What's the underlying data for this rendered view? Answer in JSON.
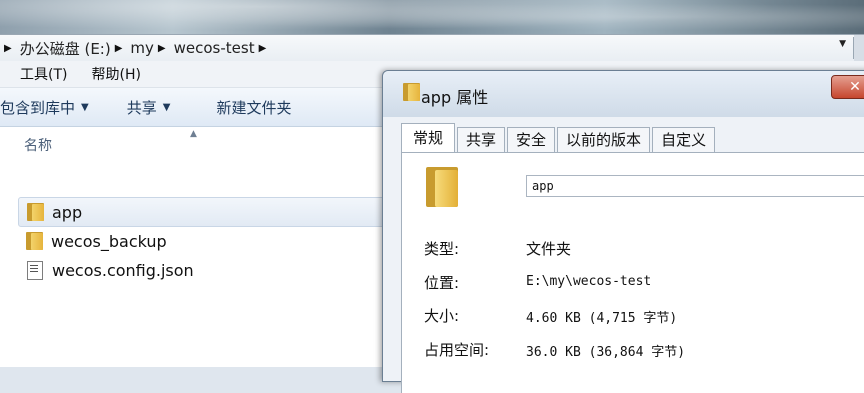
{
  "address_bar": {
    "crumbs": [
      "办公磁盘 (E:)",
      "my",
      "wecos-test"
    ]
  },
  "menubar": {
    "tools": "工具(T)",
    "help": "帮助(H)"
  },
  "toolbar": {
    "include_in_library": "包含到库中",
    "share": "共享",
    "new_folder": "新建文件夹"
  },
  "file_list": {
    "column_name": "名称",
    "items": [
      {
        "name": "app",
        "type": "folder",
        "selected": true
      },
      {
        "name": "wecos_backup",
        "type": "folder",
        "selected": false
      },
      {
        "name": "wecos.config.json",
        "type": "file",
        "selected": false
      }
    ]
  },
  "dialog": {
    "title": "app 属性",
    "tabs": [
      "常规",
      "共享",
      "安全",
      "以前的版本",
      "自定义"
    ],
    "active_tab": "常规",
    "name_value": "app",
    "properties": [
      {
        "label": "类型:",
        "value": "文件夹"
      },
      {
        "label": "位置:",
        "value": "E:\\my\\wecos-test"
      },
      {
        "label": "大小:",
        "value": "4.60 KB (4,715 字节)"
      },
      {
        "label": "占用空间:",
        "value": "36.0 KB (36,864 字节)"
      }
    ]
  },
  "colors": {
    "close_button": "#c6462e",
    "folder": "#e6b43c",
    "toolbar_text": "#1e3a5c"
  }
}
